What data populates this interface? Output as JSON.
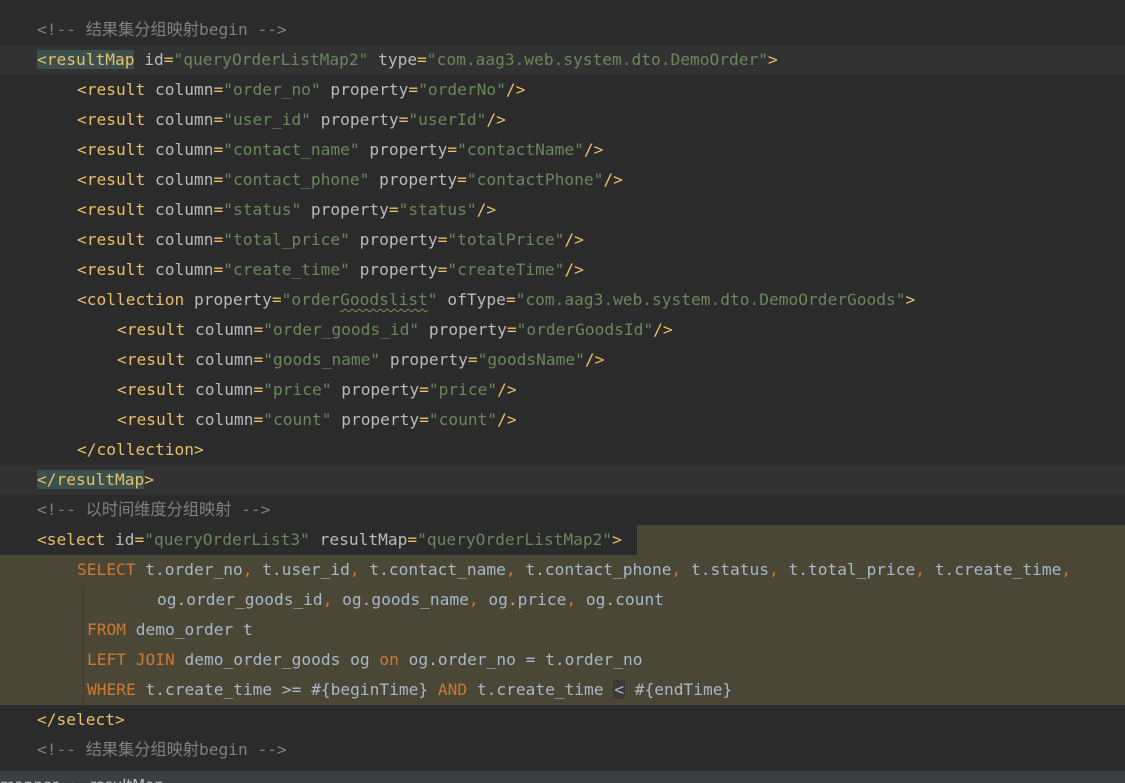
{
  "editor": {
    "language": "xml",
    "colors": {
      "background": "#2b2b2b",
      "tag": "#e8bf6a",
      "attribute": "#bababa",
      "string": "#6a8759",
      "keyword": "#cc7832",
      "comment": "#808080",
      "text": "#a9b7c6",
      "sql_injection_background": "#4a4736",
      "caret_line": "#323232"
    },
    "lines": [
      {
        "indent": 1,
        "tokens": [
          {
            "t": "c",
            "s": "<!-- 结果集分组映射begin -->"
          }
        ]
      },
      {
        "indent": 1,
        "caret": true,
        "tokens": [
          {
            "t": "tag",
            "s": "<resultMap",
            "match": true
          },
          {
            "t": "attr",
            "s": " id"
          },
          {
            "t": "tag",
            "s": "="
          },
          {
            "t": "str",
            "s": "\"queryOrderListMap2\""
          },
          {
            "t": "attr",
            "s": " type"
          },
          {
            "t": "tag",
            "s": "="
          },
          {
            "t": "str",
            "s": "\"com.aag3.web.system.dto.DemoOrder\""
          },
          {
            "t": "tag",
            "s": ">"
          }
        ]
      },
      {
        "indent": 2,
        "tokens": [
          {
            "t": "tag",
            "s": "<result"
          },
          {
            "t": "attr",
            "s": " column"
          },
          {
            "t": "tag",
            "s": "="
          },
          {
            "t": "str",
            "s": "\"order_no\""
          },
          {
            "t": "attr",
            "s": " property"
          },
          {
            "t": "tag",
            "s": "="
          },
          {
            "t": "str",
            "s": "\"orderNo\""
          },
          {
            "t": "tag",
            "s": "/>"
          }
        ]
      },
      {
        "indent": 2,
        "tokens": [
          {
            "t": "tag",
            "s": "<result"
          },
          {
            "t": "attr",
            "s": " column"
          },
          {
            "t": "tag",
            "s": "="
          },
          {
            "t": "str",
            "s": "\"user_id\""
          },
          {
            "t": "attr",
            "s": " property"
          },
          {
            "t": "tag",
            "s": "="
          },
          {
            "t": "str",
            "s": "\"userId\""
          },
          {
            "t": "tag",
            "s": "/>"
          }
        ]
      },
      {
        "indent": 2,
        "tokens": [
          {
            "t": "tag",
            "s": "<result"
          },
          {
            "t": "attr",
            "s": " column"
          },
          {
            "t": "tag",
            "s": "="
          },
          {
            "t": "str",
            "s": "\"contact_name\""
          },
          {
            "t": "attr",
            "s": " property"
          },
          {
            "t": "tag",
            "s": "="
          },
          {
            "t": "str",
            "s": "\"contactName\""
          },
          {
            "t": "tag",
            "s": "/>"
          }
        ]
      },
      {
        "indent": 2,
        "tokens": [
          {
            "t": "tag",
            "s": "<result"
          },
          {
            "t": "attr",
            "s": " column"
          },
          {
            "t": "tag",
            "s": "="
          },
          {
            "t": "str",
            "s": "\"contact_phone\""
          },
          {
            "t": "attr",
            "s": " property"
          },
          {
            "t": "tag",
            "s": "="
          },
          {
            "t": "str",
            "s": "\"contactPhone\""
          },
          {
            "t": "tag",
            "s": "/>"
          }
        ]
      },
      {
        "indent": 2,
        "tokens": [
          {
            "t": "tag",
            "s": "<result"
          },
          {
            "t": "attr",
            "s": " column"
          },
          {
            "t": "tag",
            "s": "="
          },
          {
            "t": "str",
            "s": "\"status\""
          },
          {
            "t": "attr",
            "s": " property"
          },
          {
            "t": "tag",
            "s": "="
          },
          {
            "t": "str",
            "s": "\"status\""
          },
          {
            "t": "tag",
            "s": "/>"
          }
        ]
      },
      {
        "indent": 2,
        "tokens": [
          {
            "t": "tag",
            "s": "<result"
          },
          {
            "t": "attr",
            "s": " column"
          },
          {
            "t": "tag",
            "s": "="
          },
          {
            "t": "str",
            "s": "\"total_price\""
          },
          {
            "t": "attr",
            "s": " property"
          },
          {
            "t": "tag",
            "s": "="
          },
          {
            "t": "str",
            "s": "\"totalPrice\""
          },
          {
            "t": "tag",
            "s": "/>"
          }
        ]
      },
      {
        "indent": 2,
        "tokens": [
          {
            "t": "tag",
            "s": "<result"
          },
          {
            "t": "attr",
            "s": " column"
          },
          {
            "t": "tag",
            "s": "="
          },
          {
            "t": "str",
            "s": "\"create_time\""
          },
          {
            "t": "attr",
            "s": " property"
          },
          {
            "t": "tag",
            "s": "="
          },
          {
            "t": "str",
            "s": "\"createTime\""
          },
          {
            "t": "tag",
            "s": "/>"
          }
        ]
      },
      {
        "indent": 2,
        "tokens": [
          {
            "t": "tag",
            "s": "<collection"
          },
          {
            "t": "attr",
            "s": " property"
          },
          {
            "t": "tag",
            "s": "="
          },
          {
            "t": "str",
            "s": "\"order"
          },
          {
            "t": "str",
            "s": "Goodslist",
            "typo": true
          },
          {
            "t": "str",
            "s": "\""
          },
          {
            "t": "attr",
            "s": " ofType"
          },
          {
            "t": "tag",
            "s": "="
          },
          {
            "t": "str",
            "s": "\"com.aag3.web.system.dto.DemoOrderGoods\""
          },
          {
            "t": "tag",
            "s": ">"
          }
        ]
      },
      {
        "indent": 3,
        "tokens": [
          {
            "t": "tag",
            "s": "<result"
          },
          {
            "t": "attr",
            "s": " column"
          },
          {
            "t": "tag",
            "s": "="
          },
          {
            "t": "str",
            "s": "\"order_goods_id\""
          },
          {
            "t": "attr",
            "s": " property"
          },
          {
            "t": "tag",
            "s": "="
          },
          {
            "t": "str",
            "s": "\"orderGoodsId\""
          },
          {
            "t": "tag",
            "s": "/>"
          }
        ]
      },
      {
        "indent": 3,
        "tokens": [
          {
            "t": "tag",
            "s": "<result"
          },
          {
            "t": "attr",
            "s": " column"
          },
          {
            "t": "tag",
            "s": "="
          },
          {
            "t": "str",
            "s": "\"goods_name\""
          },
          {
            "t": "attr",
            "s": " property"
          },
          {
            "t": "tag",
            "s": "="
          },
          {
            "t": "str",
            "s": "\"goodsName\""
          },
          {
            "t": "tag",
            "s": "/>"
          }
        ]
      },
      {
        "indent": 3,
        "tokens": [
          {
            "t": "tag",
            "s": "<result"
          },
          {
            "t": "attr",
            "s": " column"
          },
          {
            "t": "tag",
            "s": "="
          },
          {
            "t": "str",
            "s": "\"price\""
          },
          {
            "t": "attr",
            "s": " property"
          },
          {
            "t": "tag",
            "s": "="
          },
          {
            "t": "str",
            "s": "\"price\""
          },
          {
            "t": "tag",
            "s": "/>"
          }
        ]
      },
      {
        "indent": 3,
        "tokens": [
          {
            "t": "tag",
            "s": "<result"
          },
          {
            "t": "attr",
            "s": " column"
          },
          {
            "t": "tag",
            "s": "="
          },
          {
            "t": "str",
            "s": "\"count\""
          },
          {
            "t": "attr",
            "s": " property"
          },
          {
            "t": "tag",
            "s": "="
          },
          {
            "t": "str",
            "s": "\"count\""
          },
          {
            "t": "tag",
            "s": "/>"
          }
        ]
      },
      {
        "indent": 2,
        "tokens": [
          {
            "t": "tag",
            "s": "</collection>"
          }
        ]
      },
      {
        "indent": 1,
        "caret": true,
        "tokens": [
          {
            "t": "tag",
            "s": "</resultMap",
            "match": true
          },
          {
            "t": "tag",
            "s": ">"
          }
        ]
      },
      {
        "indent": 1,
        "tokens": [
          {
            "t": "c",
            "s": "<!-- 以时间维度分组映射 -->"
          }
        ]
      },
      {
        "indent": 1,
        "tokens": [
          {
            "t": "tag",
            "s": "<select"
          },
          {
            "t": "attr",
            "s": " id"
          },
          {
            "t": "tag",
            "s": "="
          },
          {
            "t": "str",
            "s": "\"queryOrderList3\""
          },
          {
            "t": "attr",
            "s": " resultMap"
          },
          {
            "t": "tag",
            "s": "="
          },
          {
            "t": "str",
            "s": "\"queryOrderListMap2\""
          },
          {
            "t": "tag",
            "s": ">"
          }
        ]
      },
      {
        "indent": 2,
        "sql": true,
        "tokens": [
          {
            "t": "kw",
            "s": "SELECT"
          },
          {
            "t": "p",
            "s": " t.order_no"
          },
          {
            "t": "kw",
            "s": ","
          },
          {
            "t": "p",
            "s": " t.user_id"
          },
          {
            "t": "kw",
            "s": ","
          },
          {
            "t": "p",
            "s": " t.contact_name"
          },
          {
            "t": "kw",
            "s": ","
          },
          {
            "t": "p",
            "s": " t.contact_phone"
          },
          {
            "t": "kw",
            "s": ","
          },
          {
            "t": "p",
            "s": " t.status"
          },
          {
            "t": "kw",
            "s": ","
          },
          {
            "t": "p",
            "s": " t.total_price"
          },
          {
            "t": "kw",
            "s": ","
          },
          {
            "t": "p",
            "s": " t.create_time"
          },
          {
            "t": "kw",
            "s": ","
          }
        ]
      },
      {
        "indent": 4,
        "sql": true,
        "tokens": [
          {
            "t": "p",
            "s": "og.order_goods_id"
          },
          {
            "t": "kw",
            "s": ","
          },
          {
            "t": "p",
            "s": " og.goods_name"
          },
          {
            "t": "kw",
            "s": ","
          },
          {
            "t": "p",
            "s": " og.price"
          },
          {
            "t": "kw",
            "s": ","
          },
          {
            "t": "p",
            "s": " og.count"
          }
        ]
      },
      {
        "indent": 2,
        "sql": true,
        "pad": true,
        "tokens": [
          {
            "t": "kw",
            "s": "FROM"
          },
          {
            "t": "p",
            "s": " demo_order t"
          }
        ]
      },
      {
        "indent": 2,
        "sql": true,
        "pad": true,
        "tokens": [
          {
            "t": "kw",
            "s": "LEFT JOIN"
          },
          {
            "t": "p",
            "s": " demo_order_goods og "
          },
          {
            "t": "kw",
            "s": "on"
          },
          {
            "t": "p",
            "s": " og.order_no = t.order_no"
          }
        ]
      },
      {
        "indent": 2,
        "sql": true,
        "pad": true,
        "tokens": [
          {
            "t": "kw",
            "s": "WHERE"
          },
          {
            "t": "p",
            "s": " t.create_time >= #{beginTime} "
          },
          {
            "t": "kw",
            "s": "AND"
          },
          {
            "t": "p",
            "s": " t.create_time "
          },
          {
            "t": "p",
            "s": "<",
            "box": true
          },
          {
            "t": "p",
            "s": " #{endTime}"
          }
        ]
      },
      {
        "indent": 1,
        "tokens": [
          {
            "t": "tag",
            "s": "</select>"
          }
        ]
      },
      {
        "indent": 1,
        "tokens": [
          {
            "t": "c",
            "s": "<!-- 结果集分组映射begin -->"
          }
        ]
      }
    ]
  },
  "breadcrumb": {
    "items": [
      "mapper",
      "resultMap"
    ]
  }
}
